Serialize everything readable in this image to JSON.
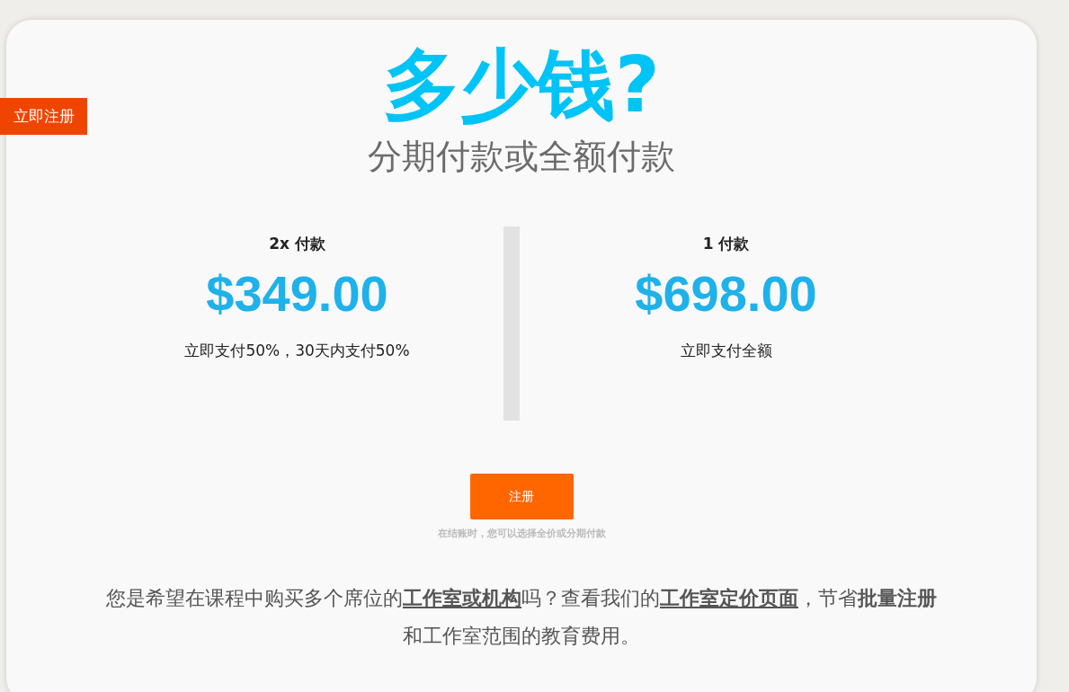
{
  "side_tab": {
    "label": "立即注册"
  },
  "title": "多少钱?",
  "subtitle": "分期付款或全额付款",
  "plans": [
    {
      "name": "2x 付款",
      "price": "$349.00",
      "description": "立即支付50%，30天内支付50%"
    },
    {
      "name": "1 付款",
      "price": "$698.00",
      "description": "立即支付全额"
    }
  ],
  "register_button": "注册",
  "checkout_note": "在结账时，您可以选择全价或分期付款",
  "footer_text": [
    {
      "kind": "text",
      "text": "您是希望在课程中购买多个席位的"
    },
    {
      "kind": "link",
      "text": "工作室或机构"
    },
    {
      "kind": "text",
      "text": "吗？查看我们的"
    },
    {
      "kind": "link",
      "text": "工作室定价页面"
    },
    {
      "kind": "text",
      "text": "，节省**批量注册**和工作室范围的教育费用。"
    }
  ]
}
